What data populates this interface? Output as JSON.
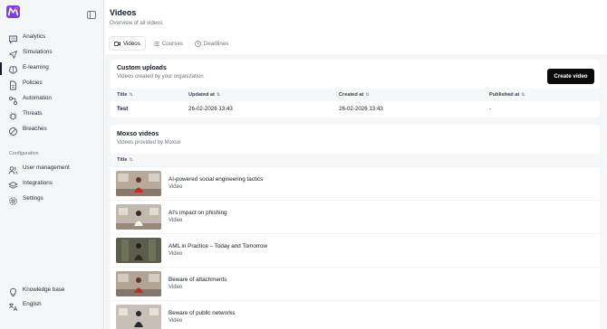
{
  "sidebar": {
    "items": [
      {
        "label": "Analytics",
        "icon": "chat-analytics-icon"
      },
      {
        "label": "Simulations",
        "icon": "send-icon"
      },
      {
        "label": "E-learning",
        "icon": "brain-icon"
      },
      {
        "label": "Policies",
        "icon": "document-icon"
      },
      {
        "label": "Automation",
        "icon": "automation-icon"
      },
      {
        "label": "Threats",
        "icon": "bug-icon"
      },
      {
        "label": "Breaches",
        "icon": "no-entry-icon"
      }
    ],
    "section_label": "Configuration",
    "config_items": [
      {
        "label": "User management",
        "icon": "users-icon"
      },
      {
        "label": "Integrations",
        "icon": "layers-icon"
      },
      {
        "label": "Settings",
        "icon": "gear-icon"
      }
    ],
    "bottom_items": [
      {
        "label": "Knowledge base",
        "icon": "lightbulb-icon"
      },
      {
        "label": "English",
        "icon": "language-icon"
      }
    ]
  },
  "header": {
    "title": "Videos",
    "subtitle": "Overview of all videos"
  },
  "tabs": [
    {
      "label": "Videos",
      "active": true
    },
    {
      "label": "Courses",
      "active": false
    },
    {
      "label": "Deadlines",
      "active": false
    }
  ],
  "custom_uploads": {
    "title": "Custom uploads",
    "subtitle": "Videos created by your organization",
    "create_button": "Create video",
    "columns": [
      "Title",
      "Updated at",
      "Created at",
      "Published at"
    ],
    "rows": [
      {
        "title": "Test",
        "updated": "26-02-2026 13:43",
        "created": "26-02-2026 13:43",
        "published": "-"
      }
    ]
  },
  "moxso_videos": {
    "title": "Moxso videos",
    "subtitle": "Videos provided by Moxso",
    "column": "Title",
    "items": [
      {
        "title": "AI-powered social engineering tactics",
        "type": "Video"
      },
      {
        "title": "AI's impact on phishing",
        "type": "Video"
      },
      {
        "title": "AML in Practice – Today and Tomorrow",
        "type": "Video"
      },
      {
        "title": "Beware of attachments",
        "type": "Video"
      },
      {
        "title": "Beware of public networks",
        "type": "Video"
      }
    ]
  },
  "colors": {
    "accent": "#0b0b0b",
    "sidebar_bg": "#f4f5f7",
    "logo_purple": "#7b3fe4",
    "logo_pink": "#f0438f"
  }
}
